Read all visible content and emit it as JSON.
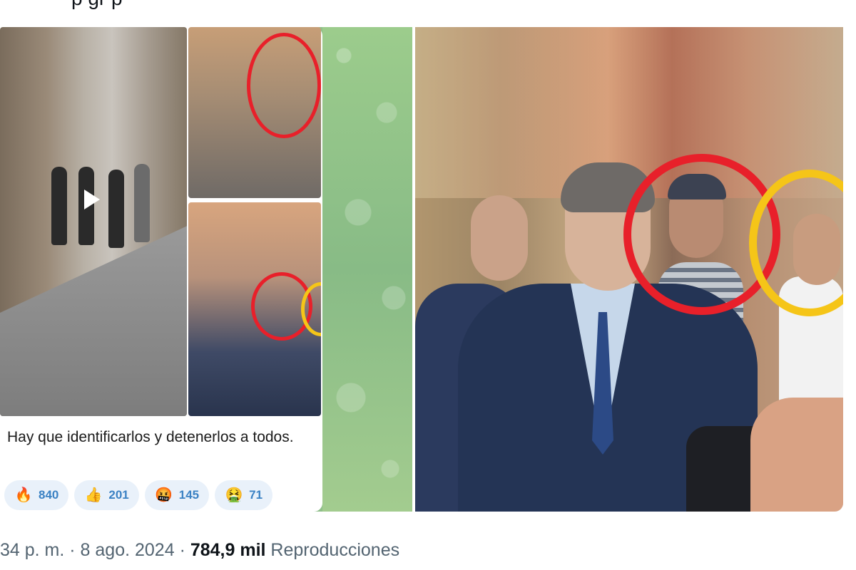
{
  "tweet": {
    "top_text_fragment": "p gr p"
  },
  "telegram_message": {
    "caption": "Hay que identificarlos y detenerlos a todos.",
    "reactions": [
      {
        "emoji": "🔥",
        "icon": "fire-icon",
        "count": "840"
      },
      {
        "emoji": "👍",
        "icon": "thumbs-up-icon",
        "count": "201"
      },
      {
        "emoji": "🤬",
        "icon": "angry-face-icon",
        "count": "145"
      },
      {
        "emoji": "🤮",
        "icon": "vomit-face-icon",
        "count": "71"
      }
    ]
  },
  "colors": {
    "circle_red": "#e8202a",
    "circle_yellow": "#f5c518",
    "reaction_bg": "#e9f1fa",
    "reaction_text": "#3b82c4",
    "meta_gray": "#536471"
  },
  "meta": {
    "time": "34 p. m.",
    "sep1": " · ",
    "date": "8 ago. 2024",
    "sep2": " · ",
    "views": "784,9 mil",
    "views_label": " Reproducciones"
  }
}
